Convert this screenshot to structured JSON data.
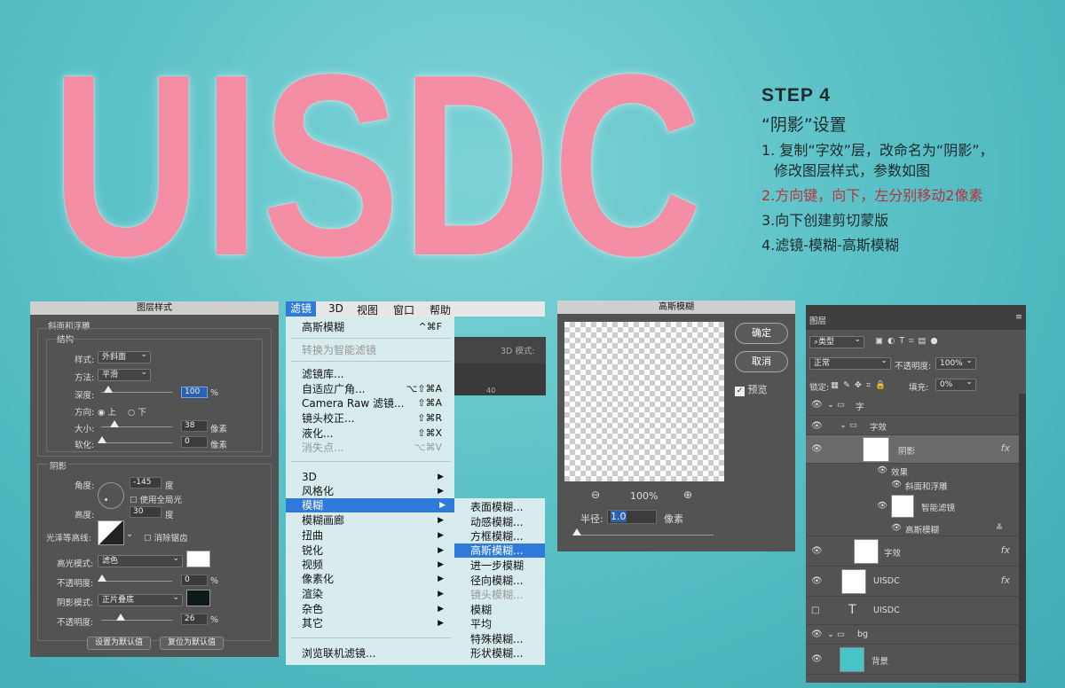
{
  "hero": {
    "title": "UISDC"
  },
  "step": {
    "heading": "STEP 4",
    "subtitle": "“阴影”设置",
    "lines": [
      "1. 复制“字效”层，改命名为“阴影”，",
      "修改图层样式，参数如图",
      "2.方向键，向下，左分别移动2像素",
      "3.向下创建剪切蒙版",
      "4.滤镜-模糊-高斯模糊"
    ]
  },
  "layer_style": {
    "title": "图层样式",
    "bevel_group": "斜面和浮雕",
    "structure": "结构",
    "style_label": "样式:",
    "style_value": "外斜面",
    "method_label": "方法:",
    "method_value": "平滑",
    "depth_label": "深度:",
    "depth_value": "100",
    "pct": "%",
    "direction_label": "方向:",
    "dir_up": "上",
    "dir_down": "下",
    "size_label": "大小:",
    "size_value": "38",
    "px": "像素",
    "soften_label": "软化:",
    "soften_value": "0",
    "shading": "阴影",
    "angle_label": "角度:",
    "angle_value": "-145",
    "deg": "度",
    "global_light": "使用全局光",
    "altitude_label": "高度:",
    "altitude_value": "30",
    "gloss_label": "光泽等高线:",
    "anti_alias": "消除锯齿",
    "highlight_label": "高光模式:",
    "highlight_value": "滤色",
    "hl_opacity_label": "不透明度:",
    "hl_opacity_value": "0",
    "shadow_label": "阴影模式:",
    "shadow_value": "正片叠底",
    "sh_opacity_label": "不透明度:",
    "sh_opacity_value": "26",
    "default_btn": "设置为默认值",
    "reset_btn": "复位为默认值",
    "highlight_color": "#ffffff",
    "shadow_color": "#0d1a1c"
  },
  "menubar": {
    "items": [
      "滤镜",
      "3D",
      "视图",
      "窗口",
      "帮助"
    ]
  },
  "filter_menu": {
    "last": "高斯模糊",
    "last_sc": "^⌘F",
    "smart": "转换为智能滤镜",
    "gallery": "滤镜库...",
    "adaptive": "自适应广角...",
    "adaptive_sc": "⌥⇧⌘A",
    "camera": "Camera Raw 滤镜...",
    "camera_sc": "⇧⌘A",
    "lens": "镜头校正...",
    "lens_sc": "⇧⌘R",
    "liquify": "液化...",
    "liquify_sc": "⇧⌘X",
    "vanish": "消失点...",
    "vanish_sc": "⌥⌘V",
    "d3": "3D",
    "stylize": "风格化",
    "blur": "模糊",
    "blur_gallery": "模糊画廊",
    "distort": "扭曲",
    "sharpen": "锐化",
    "video": "视频",
    "pixelate": "像素化",
    "render": "渲染",
    "noise": "杂色",
    "other": "其它",
    "browse": "浏览联机滤镜..."
  },
  "blur_submenu": [
    "表面模糊...",
    "动感模糊...",
    "方框模糊...",
    "高斯模糊...",
    "进一步模糊",
    "径向模糊...",
    "镜头模糊...",
    "模糊",
    "平均",
    "特殊模糊...",
    "形状模糊..."
  ],
  "toolbar_bg": {
    "mode": "3D 模式:",
    "ruler": "40"
  },
  "gaussian": {
    "title": "高斯模糊",
    "ok": "确定",
    "cancel": "取消",
    "preview": "预览",
    "zoom": "100%",
    "radius_label": "半径:",
    "radius_value": "1.0",
    "unit": "像素"
  },
  "layers": {
    "title": "图层",
    "kind": "类型",
    "blend": "正常",
    "opacity_label": "不透明度:",
    "opacity_value": "100%",
    "lock_label": "锁定:",
    "fill_label": "填充:",
    "fill_value": "0%",
    "rows": {
      "g_zi": "字",
      "g_ziyao": "字效",
      "shadow": "阴影",
      "effects": "效果",
      "bevel": "斜面和浮雕",
      "smart": "智能滤镜",
      "gauss": "高斯模糊",
      "ziyao": "字效",
      "uisdc1": "UISDC",
      "uisdc2": "UISDC",
      "bg_group": "bg",
      "bg_layer": "背景"
    },
    "fx": "fx",
    "bg_color": "#48c3c8"
  }
}
